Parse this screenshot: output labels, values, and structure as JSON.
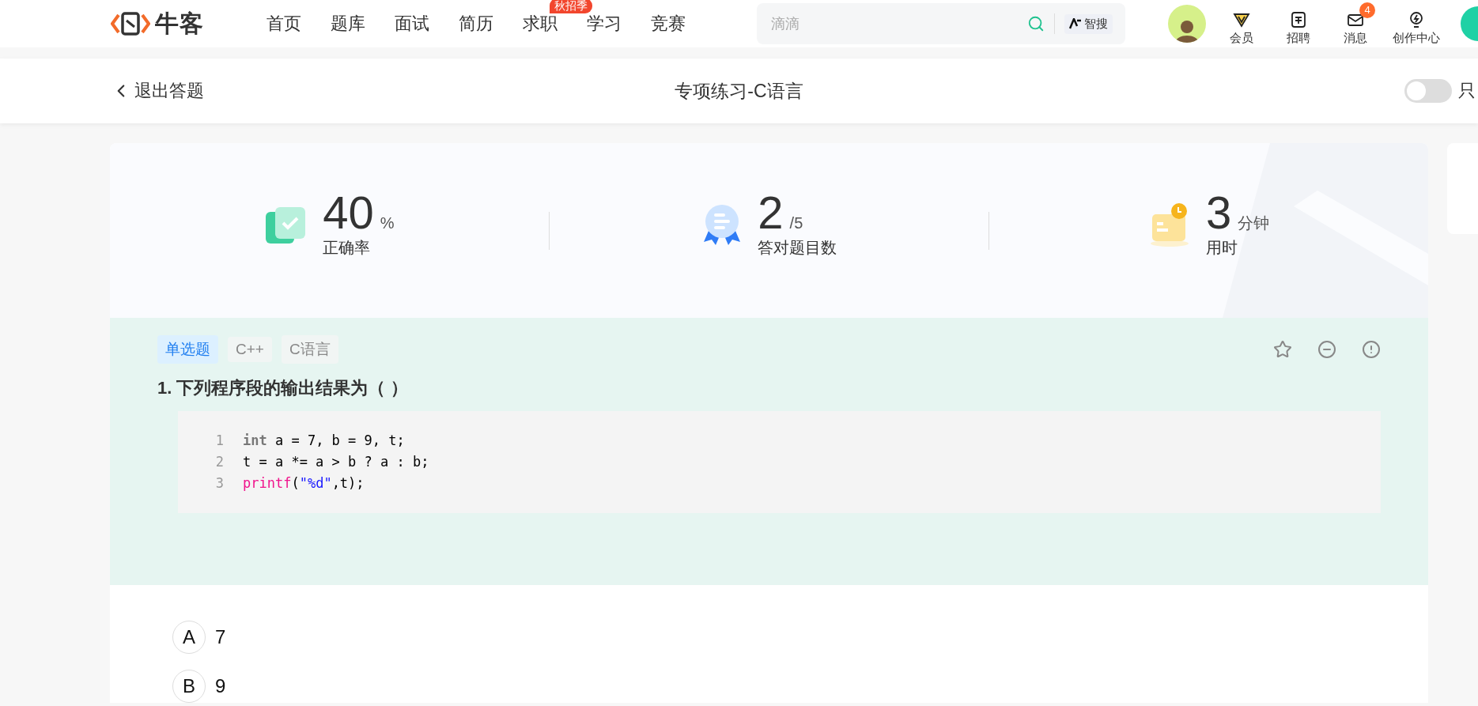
{
  "nav": {
    "logo": "牛客",
    "items": [
      {
        "label": "首页",
        "selected": false
      },
      {
        "label": "题库",
        "selected": false
      },
      {
        "label": "面试",
        "selected": false
      },
      {
        "label": "简历",
        "selected": false
      },
      {
        "label": "求职",
        "selected": false,
        "badge": "秋招季"
      },
      {
        "label": "学习",
        "selected": false
      },
      {
        "label": "竞赛",
        "selected": false
      }
    ],
    "search": {
      "placeholder": "滴滴",
      "ai_label": "智搜"
    },
    "user_menu": [
      {
        "label": "会员",
        "kind": "vip"
      },
      {
        "label": "招聘",
        "kind": "recruit"
      },
      {
        "label": "消息",
        "kind": "message",
        "badge": "4"
      },
      {
        "label": "创作中心",
        "kind": "create"
      }
    ]
  },
  "header": {
    "back": "退出答题",
    "title": "专项练习-C语言",
    "toggle": {
      "label": "只",
      "on": false
    }
  },
  "stats": [
    {
      "kind": "accuracy",
      "value": "40",
      "unit": "%",
      "label": "正确率"
    },
    {
      "kind": "correct",
      "value": "2",
      "unit": "/5",
      "label": "答对题目数"
    },
    {
      "kind": "time",
      "value": "3",
      "unit": "分钟",
      "label": "用时"
    }
  ],
  "question": {
    "tags": [
      {
        "label": "单选题",
        "kind": "type"
      },
      {
        "label": "C++",
        "kind": "topic"
      },
      {
        "label": "C语言",
        "kind": "topic"
      }
    ],
    "title": "1. 下列程序段的输出结果为（ ）",
    "code": [
      {
        "number": "1",
        "tokens": [
          {
            "t": "int",
            "kind": "keyword"
          },
          {
            "t": " a = 7, b = 9, t;",
            "kind": "plain"
          }
        ]
      },
      {
        "number": "2",
        "tokens": [
          {
            "t": "t = a *= a > b ? a : b;",
            "kind": "plain"
          }
        ]
      },
      {
        "number": "3",
        "tokens": [
          {
            "t": "printf",
            "kind": "function"
          },
          {
            "t": "(",
            "kind": "plain"
          },
          {
            "t": "\"%d\"",
            "kind": "string"
          },
          {
            "t": ",t);",
            "kind": "plain"
          }
        ]
      }
    ]
  },
  "options": [
    {
      "letter": "A",
      "text": "7",
      "selected": false
    },
    {
      "letter": "B",
      "text": "9",
      "selected": false
    }
  ]
}
